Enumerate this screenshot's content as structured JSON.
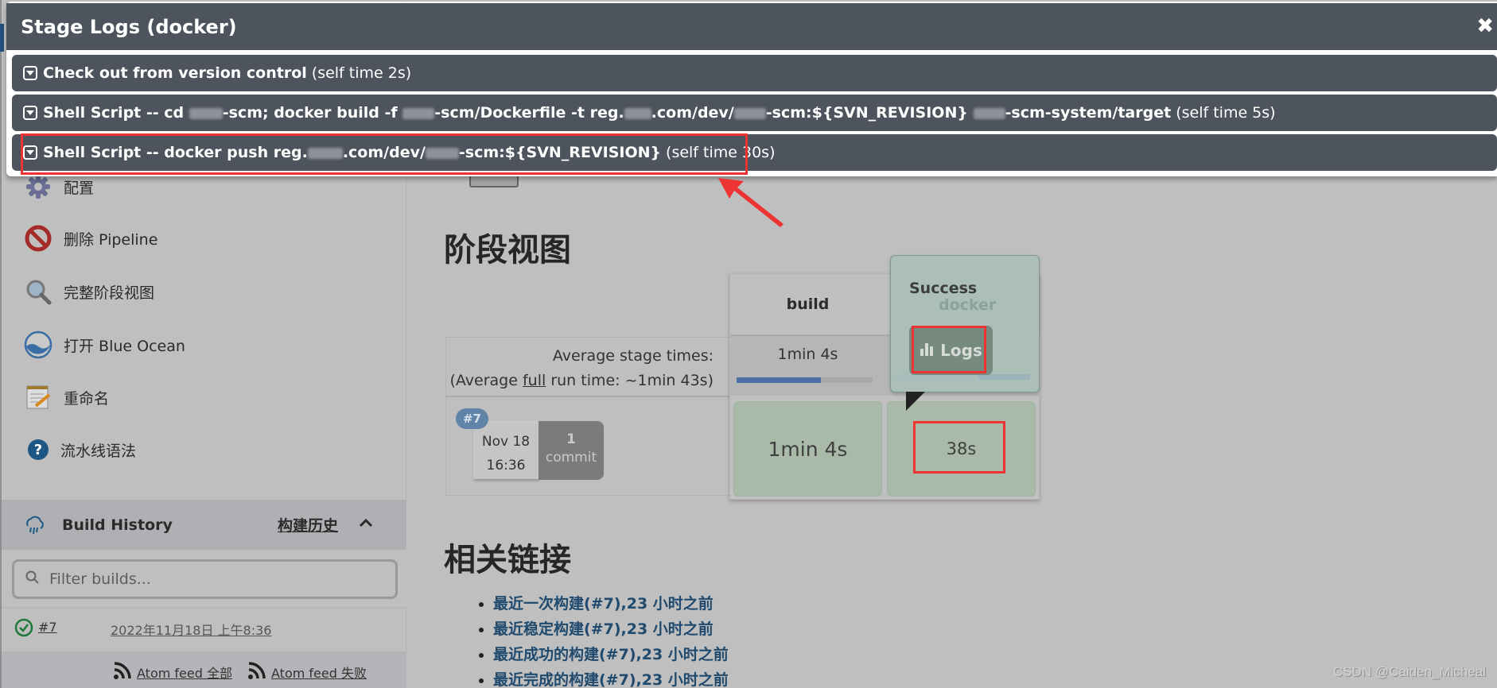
{
  "sidebar": {
    "tasks": [
      {
        "label": "配置",
        "icon": "gear-icon"
      },
      {
        "label": "删除 Pipeline",
        "icon": "no-entry-icon"
      },
      {
        "label": "完整阶段视图",
        "icon": "magnifier-icon"
      },
      {
        "label": "打开 Blue Ocean",
        "icon": "blue-ocean-icon"
      },
      {
        "label": "重命名",
        "icon": "notepad-pencil-icon"
      },
      {
        "label": "流水线语法",
        "icon": "help-icon"
      }
    ],
    "build_history": {
      "title": "Build History",
      "trend_link": "构建历史",
      "filter_placeholder": "Filter builds...",
      "builds": [
        {
          "number": "#7",
          "date": "2022年11月18日 上午8:36",
          "status": "success"
        }
      ],
      "feeds": [
        "Atom feed 全部",
        "Atom feed 失败"
      ]
    }
  },
  "main": {
    "stage_view_title": "阶段视图",
    "avg_stage_times_label": "Average stage times:",
    "avg_full_prefix": "(Average ",
    "avg_full_link": "full",
    "avg_full_suffix": " run time: ~1min 43s)",
    "stages": [
      {
        "name": "build",
        "avg_time": "1min 4s",
        "avg_progress": 0.62
      },
      {
        "name": "docker",
        "avg_time": "38s",
        "avg_progress": 0.38
      }
    ],
    "run": {
      "badge": "#7",
      "date": "Nov 18",
      "time": "16:36",
      "commit_count": "1",
      "commit_label": "commit",
      "stage_times": [
        "1min 4s",
        "38s"
      ]
    },
    "popover": {
      "status": "Success",
      "stage": "docker",
      "logs_button": "Logs"
    },
    "related_title": "相关链接",
    "related_links": [
      "最近一次构建(#7),23 小时之前",
      "最近稳定构建(#7),23 小时之前",
      "最近成功的构建(#7),23 小时之前",
      "最近完成的构建(#7),23 小时之前"
    ]
  },
  "modal": {
    "title": "Stage Logs (docker)",
    "close": "✖",
    "steps": [
      {
        "name": "Check out from version control",
        "self_time": "(self time 2s)"
      },
      {
        "name_parts": [
          "Shell Script -- cd ",
          "-scm; docker build -f ",
          "-scm/Dockerfile -t reg.",
          ".com/dev/",
          "-scm:${SVN_REVISION} ",
          "-scm-system/target"
        ],
        "self_time": "(self time 5s)"
      },
      {
        "name_parts": [
          "Shell Script -- docker push reg.",
          ".com/dev/",
          "-scm:${SVN_REVISION}"
        ],
        "self_time": "(self time 30s)"
      }
    ]
  },
  "watermark": "CSDN @Caiden_Micheal",
  "colors": {
    "modal_bg": "#4e545d",
    "annotation_red": "#ee3333",
    "success_green": "#a9bba8",
    "link_blue": "#1f4a6e",
    "run_badge": "#5f84a8"
  }
}
